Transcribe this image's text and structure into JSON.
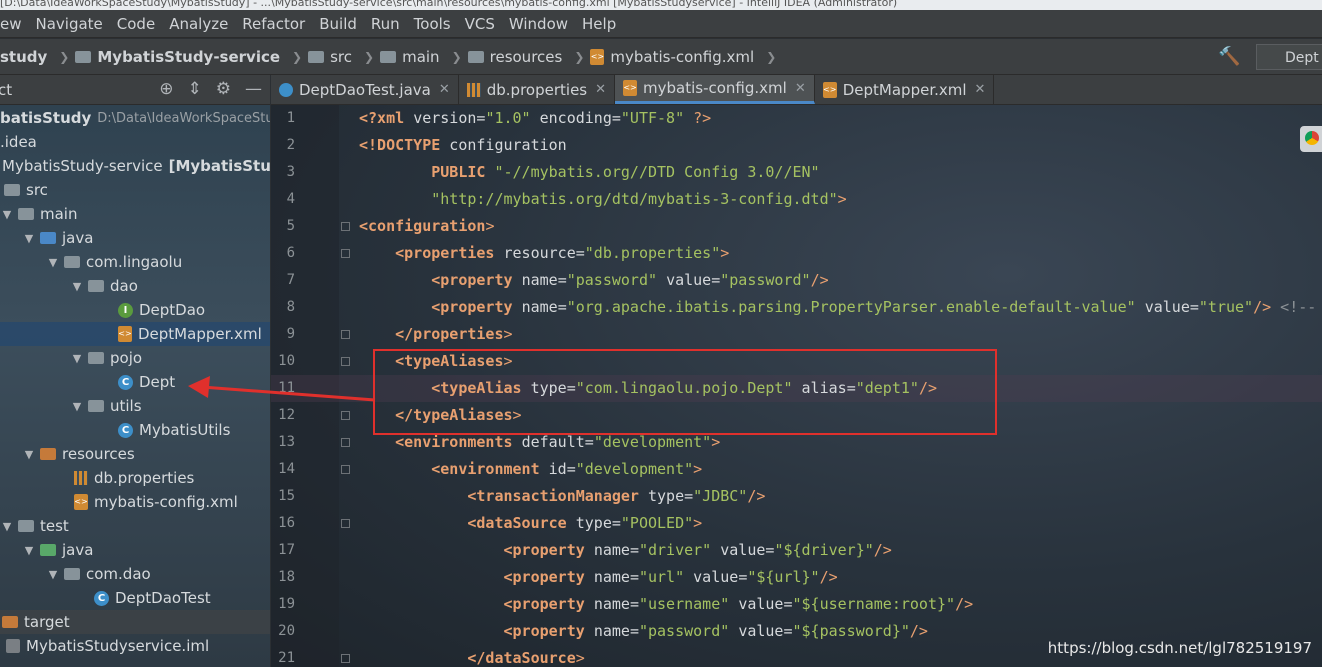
{
  "window": {
    "title": "[D:\\Data\\IdeaWorkSpaceStudy\\MybatisStudy] - ...\\MybatisStudy-service\\src\\main\\resources\\mybatis-config.xml [MybatisStudyservice] - IntelliJ IDEA (Administrator)"
  },
  "menu": [
    "ew",
    "Navigate",
    "Code",
    "Analyze",
    "Refactor",
    "Build",
    "Run",
    "Tools",
    "VCS",
    "Window",
    "Help"
  ],
  "breadcrumb": [
    "study",
    "MybatisStudy-service",
    "src",
    "main",
    "resources",
    "mybatis-config.xml"
  ],
  "run_config": "Dept",
  "project_panel": {
    "title": "ct"
  },
  "tree": [
    {
      "label": "batisStudy",
      "extra": "D:\\Data\\IdeaWorkSpaceStud",
      "bold": true
    },
    {
      "label": ".idea"
    },
    {
      "label": "MybatisStudy-service",
      "extra": "[MybatisStudyser"
    },
    {
      "label": "src"
    },
    {
      "label": "main"
    },
    {
      "label": "java"
    },
    {
      "label": "com.lingaolu"
    },
    {
      "label": "dao"
    },
    {
      "label": "DeptDao"
    },
    {
      "label": "DeptMapper.xml"
    },
    {
      "label": "pojo"
    },
    {
      "label": "Dept"
    },
    {
      "label": "utils"
    },
    {
      "label": "MybatisUtils"
    },
    {
      "label": "resources"
    },
    {
      "label": "db.properties"
    },
    {
      "label": "mybatis-config.xml"
    },
    {
      "label": "test"
    },
    {
      "label": "java"
    },
    {
      "label": "com.dao"
    },
    {
      "label": "DeptDaoTest"
    },
    {
      "label": "target"
    },
    {
      "label": "MybatisStudyservice.iml"
    }
  ],
  "tabs": [
    {
      "label": "DeptDaoTest.java",
      "active": false
    },
    {
      "label": "db.properties",
      "active": false
    },
    {
      "label": "mybatis-config.xml",
      "active": true
    },
    {
      "label": "DeptMapper.xml",
      "active": false
    }
  ],
  "code_lines": [
    {
      "n": "1",
      "t": "<?xml version=\"1.0\" encoding=\"UTF-8\" ?>"
    },
    {
      "n": "2",
      "t": "<!DOCTYPE configuration"
    },
    {
      "n": "3",
      "t": "        PUBLIC \"-//mybatis.org//DTD Config 3.0//EN\""
    },
    {
      "n": "4",
      "t": "        \"http://mybatis.org/dtd/mybatis-3-config.dtd\">"
    },
    {
      "n": "5",
      "t": "<configuration>"
    },
    {
      "n": "6",
      "t": "    <properties resource=\"db.properties\">"
    },
    {
      "n": "7",
      "t": "        <property name=\"password\" value=\"password\"/>"
    },
    {
      "n": "8",
      "t": "        <property name=\"org.apache.ibatis.parsing.PropertyParser.enable-default-value\" value=\"true\"/> <!--"
    },
    {
      "n": "9",
      "t": "    </properties>"
    },
    {
      "n": "10",
      "t": "    <typeAliases>"
    },
    {
      "n": "11",
      "t": "        <typeAlias type=\"com.lingaolu.pojo.Dept\" alias=\"dept1\"/>"
    },
    {
      "n": "12",
      "t": "    </typeAliases>"
    },
    {
      "n": "13",
      "t": "    <environments default=\"development\">"
    },
    {
      "n": "14",
      "t": "        <environment id=\"development\">"
    },
    {
      "n": "15",
      "t": "            <transactionManager type=\"JDBC\"/>"
    },
    {
      "n": "16",
      "t": "            <dataSource type=\"POOLED\">"
    },
    {
      "n": "17",
      "t": "                <property name=\"driver\" value=\"${driver}\"/>"
    },
    {
      "n": "18",
      "t": "                <property name=\"url\" value=\"${url}\"/>"
    },
    {
      "n": "19",
      "t": "                <property name=\"username\" value=\"${username:root}\"/>"
    },
    {
      "n": "20",
      "t": "                <property name=\"password\" value=\"${password}\"/>"
    },
    {
      "n": "21",
      "t": "            </dataSource>"
    }
  ],
  "watermark": "https://blog.csdn.net/lgl782519197",
  "colors": {
    "tag": "#e8a070",
    "value": "#a5c261",
    "highlight": "#e0302c",
    "selection": "#26486e"
  }
}
